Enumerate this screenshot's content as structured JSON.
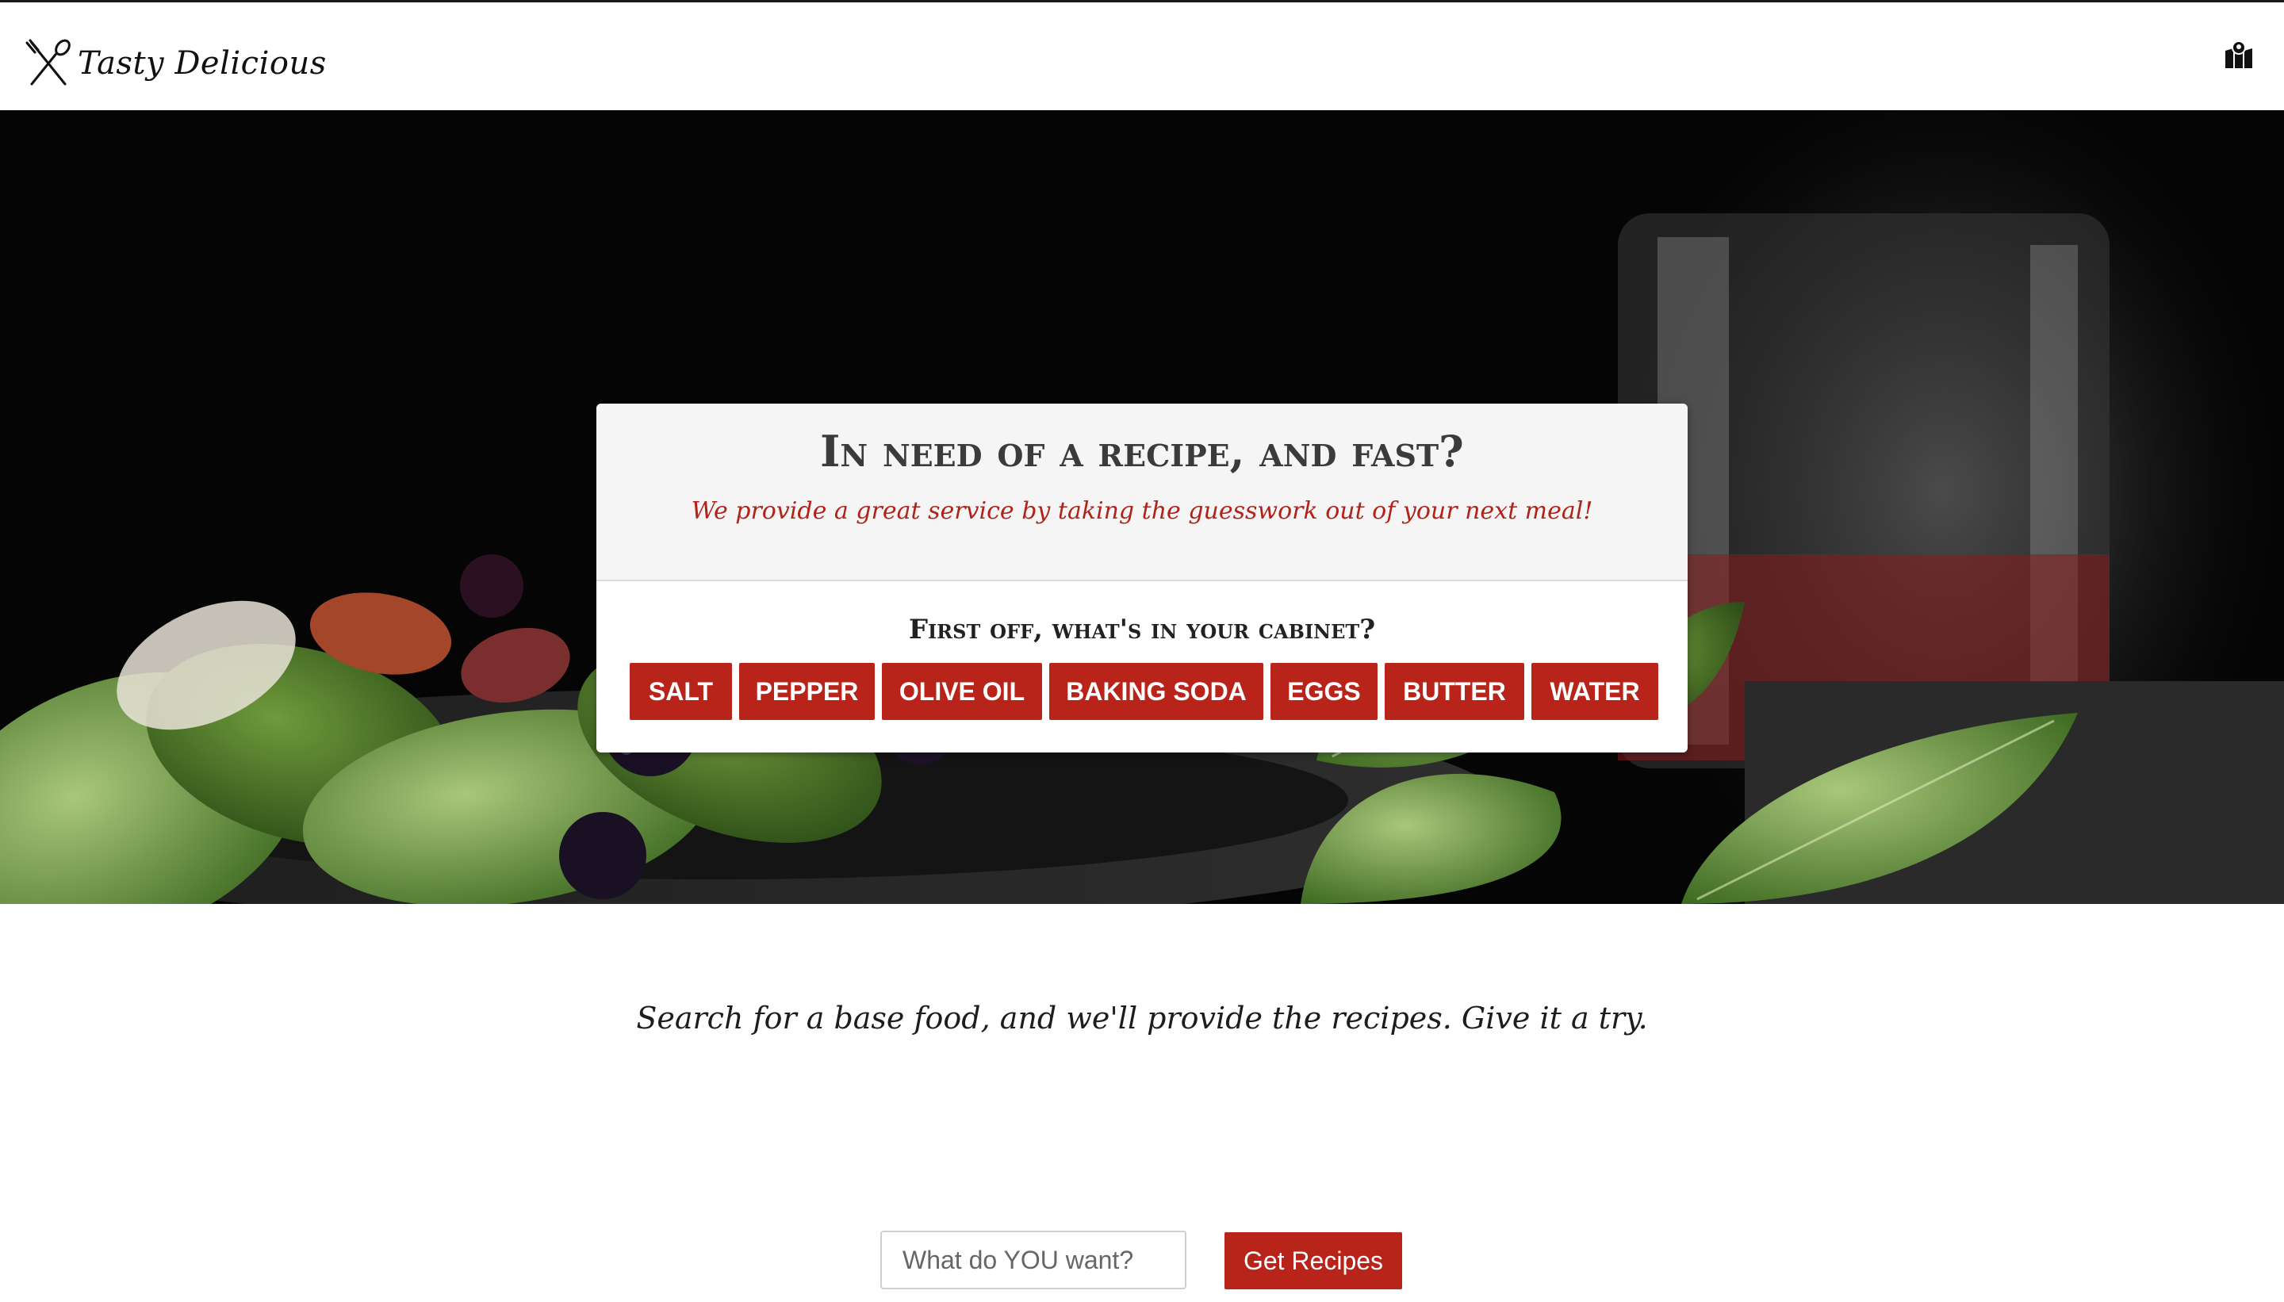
{
  "navbar": {
    "brand_name": "Tasty Delicious",
    "brand_icon": "fork-spoon-icon",
    "right_icon": "map-marker-icon"
  },
  "hero": {
    "card": {
      "title": "In need of a recipe, and fast?",
      "subtitle": "We provide a great service by taking the guesswork out of your next meal!",
      "question": "First off, what's in your cabinet?",
      "ingredients": [
        "SALT",
        "PEPPER",
        "OLIVE OIL",
        "BAKING SODA",
        "EGGS",
        "BUTTER",
        "WATER"
      ]
    }
  },
  "main": {
    "tagline": "Search for a base food, and we'll provide the recipes. Give it a try."
  },
  "search": {
    "placeholder": "What do YOU want?",
    "value": "",
    "button_label": "Get Recipes"
  },
  "colors": {
    "accent": "#b8231a",
    "hero_background": "#050505",
    "card_header": "#f5f5f5",
    "subtitle": "#b22218"
  }
}
